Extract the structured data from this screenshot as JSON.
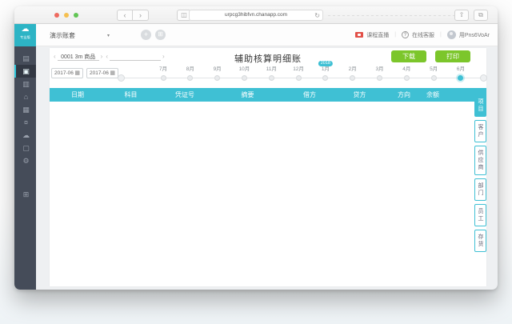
{
  "colors": {
    "accent": "#3fc0d4",
    "logo": "#2db4c5",
    "green": "#7cc62b",
    "sidebar": "#454c59"
  },
  "browser": {
    "url": "urpcg3hibfvn.chanapp.com",
    "back_icon": "‹",
    "forward_icon": "›",
    "sidebar_icon": "◫",
    "refresh_icon": "↻",
    "share_icon": "⇧",
    "tabs_icon": "⧉"
  },
  "app_header": {
    "logo_cloud_icon": "☁",
    "logo_text": "专业版",
    "workspace": "演示账套",
    "caret_icon": "▾",
    "add_icon": "+",
    "grid_icon": "⊞",
    "live_label": "课程直播",
    "support_icon": "?",
    "support_label": "在线客服",
    "separator": "|",
    "username": "用Pns6VoAr"
  },
  "sidebar": {
    "items": [
      {
        "name": "sidebar-item-ledger-icon",
        "glyph": "▤"
      },
      {
        "name": "sidebar-item-voucher-icon",
        "glyph": "▣",
        "selected": true
      },
      {
        "name": "sidebar-item-reports-icon",
        "glyph": "▥"
      },
      {
        "name": "sidebar-item-bank-icon",
        "glyph": "⌂"
      },
      {
        "name": "sidebar-item-calendar-icon",
        "glyph": "▦"
      },
      {
        "name": "sidebar-item-funds-icon",
        "glyph": "¤"
      },
      {
        "name": "sidebar-item-cloud-icon",
        "glyph": "☁"
      },
      {
        "name": "sidebar-item-inventory-icon",
        "glyph": "▢"
      },
      {
        "name": "sidebar-item-settings-icon",
        "glyph": "⚙"
      },
      {
        "name": "sidebar-item-market-icon",
        "glyph": "⊞",
        "cls": "bottom"
      }
    ]
  },
  "page": {
    "prev_icon": "‹",
    "next_icon": "›",
    "entity": "0001 3m 商品",
    "entity_secondary": "",
    "title": "辅助核算明细账",
    "download_label": "下载",
    "print_label": "打印",
    "date_from": "2017-06",
    "date_to": "2017-06",
    "calendar_icon": "▦"
  },
  "timeline": {
    "months": [
      {
        "name": "timeline-month-jul",
        "label": "7月"
      },
      {
        "name": "timeline-month-aug",
        "label": "8月"
      },
      {
        "name": "timeline-month-sep",
        "label": "9月"
      },
      {
        "name": "timeline-month-oct",
        "label": "10月"
      },
      {
        "name": "timeline-month-nov",
        "label": "11月"
      },
      {
        "name": "timeline-month-dec",
        "label": "12月"
      },
      {
        "name": "timeline-month-jan",
        "label": "1月",
        "badge": "2018"
      },
      {
        "name": "timeline-month-feb",
        "label": "2月"
      },
      {
        "name": "timeline-month-mar",
        "label": "3月"
      },
      {
        "name": "timeline-month-apr",
        "label": "4月"
      },
      {
        "name": "timeline-month-may",
        "label": "5月"
      },
      {
        "name": "timeline-month-jun",
        "label": "6月",
        "selected": true
      }
    ]
  },
  "table": {
    "columns": [
      "日期",
      "科目",
      "凭证号",
      "摘要",
      "借方",
      "贷方",
      "方向",
      "余额"
    ]
  },
  "right_tabs": [
    {
      "name": "tab-project",
      "label": "项目",
      "selected": true
    },
    {
      "name": "tab-customer",
      "label": "客户"
    },
    {
      "name": "tab-supplier",
      "label": "供应商"
    },
    {
      "name": "tab-department",
      "label": "部门"
    },
    {
      "name": "tab-employee",
      "label": "员工"
    },
    {
      "name": "tab-stock",
      "label": "存货"
    }
  ]
}
